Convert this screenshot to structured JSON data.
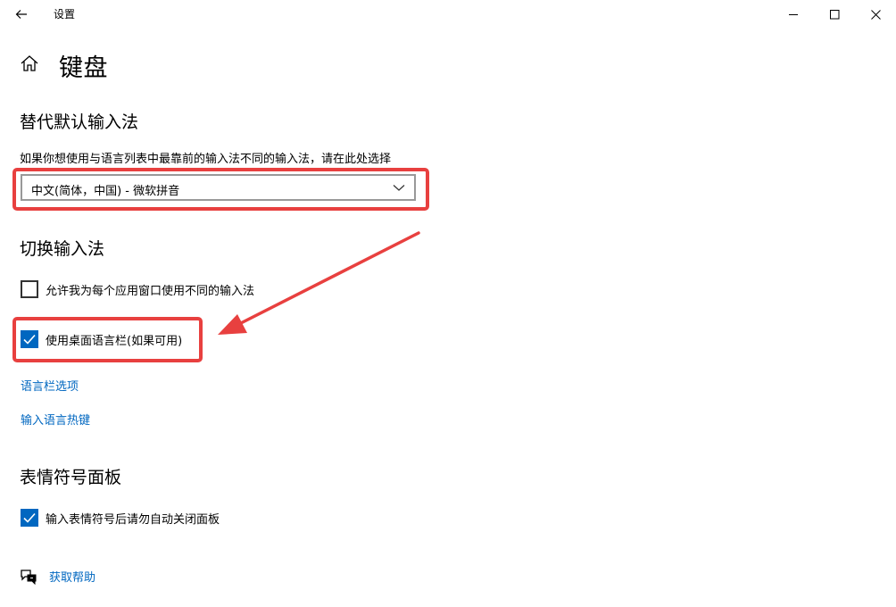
{
  "window": {
    "title": "设置"
  },
  "page": {
    "title": "键盘"
  },
  "sections": {
    "override": {
      "heading": "替代默认输入法",
      "description": "如果你想使用与语言列表中最靠前的输入法不同的输入法，请在此处选择",
      "dropdown_value": "中文(简体，中国) - 微软拼音"
    },
    "switch": {
      "heading": "切换输入法",
      "checkbox_per_app": {
        "label": "允许我为每个应用窗口使用不同的输入法",
        "checked": false
      },
      "checkbox_language_bar": {
        "label": "使用桌面语言栏(如果可用)",
        "checked": true
      },
      "link_language_bar_options": "语言栏选项",
      "link_hotkeys": "输入语言热键"
    },
    "emoji": {
      "heading": "表情符号面板",
      "checkbox_dont_close": {
        "label": "输入表情符号后请勿自动关闭面板",
        "checked": true
      }
    }
  },
  "help": {
    "label": "获取帮助"
  },
  "icons": {
    "back": "back-arrow-icon",
    "minimize": "minimize-icon",
    "maximize": "maximize-icon",
    "close": "close-icon",
    "home": "home-icon",
    "chevron": "chevron-down-icon",
    "check": "checkmark-icon",
    "help": "help-chat-icon"
  },
  "colors": {
    "accent": "#0067c0",
    "annotation": "#e8403f"
  }
}
